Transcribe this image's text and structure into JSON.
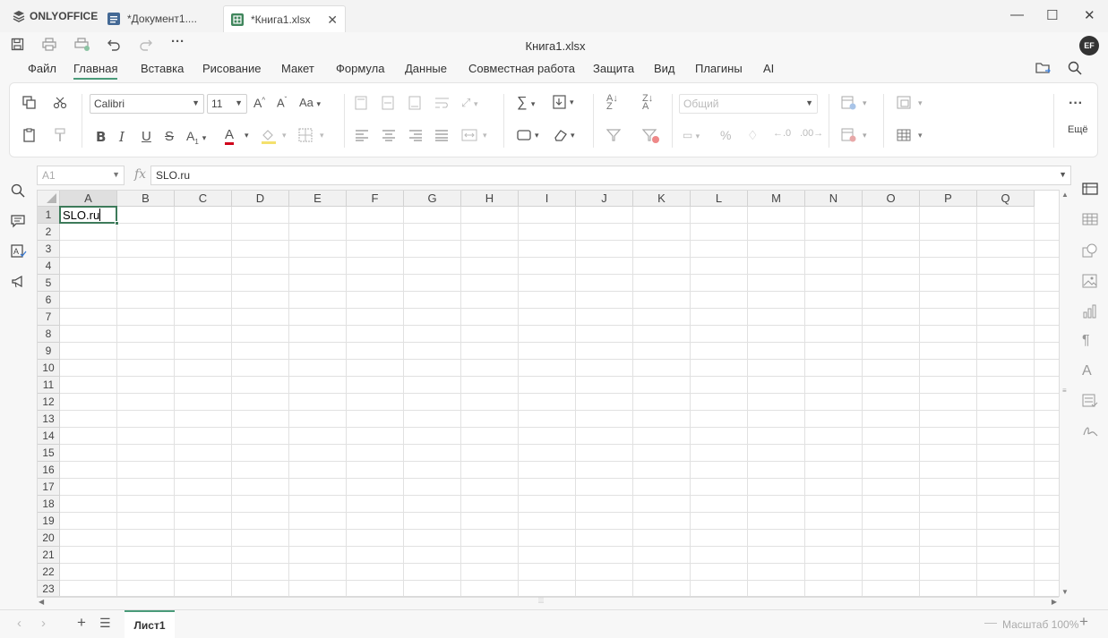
{
  "app": {
    "logo": "ONLYOFFICE"
  },
  "tabs": [
    {
      "label": "*Документ1...."
    },
    {
      "label": "*Книга1.xlsx"
    }
  ],
  "colors": {
    "accent": "#4a9b7a",
    "doc_blue": "#446995",
    "sheet_green": "#40865c"
  },
  "toolbar": {
    "title": "Книга1.xlsx",
    "user_initials": "EF"
  },
  "menu": [
    "Файл",
    "Главная",
    "Вставка",
    "Рисование",
    "Макет",
    "Формула",
    "Данные",
    "Совместная работа",
    "Защита",
    "Вид",
    "Плагины",
    "AI"
  ],
  "ribbon": {
    "font_name": "Calibri",
    "font_size": "11",
    "number_format": "Общий",
    "more_label": "Ещё"
  },
  "formula": {
    "cell_ref": "A1",
    "value": "SLO.ru"
  },
  "columns": [
    "A",
    "B",
    "C",
    "D",
    "E",
    "F",
    "G",
    "H",
    "I",
    "J",
    "K",
    "L",
    "M",
    "N",
    "O",
    "P",
    "Q"
  ],
  "rows": [
    "1",
    "2",
    "3",
    "4",
    "5",
    "6",
    "7",
    "8",
    "9",
    "10",
    "11",
    "12",
    "13",
    "14",
    "15",
    "16",
    "17",
    "18",
    "19",
    "20",
    "21",
    "22",
    "23"
  ],
  "cells": {
    "A1": "SLO.ru"
  },
  "sheets": [
    {
      "name": "Лист1"
    }
  ],
  "zoom": {
    "label": "Масштаб 100%"
  }
}
